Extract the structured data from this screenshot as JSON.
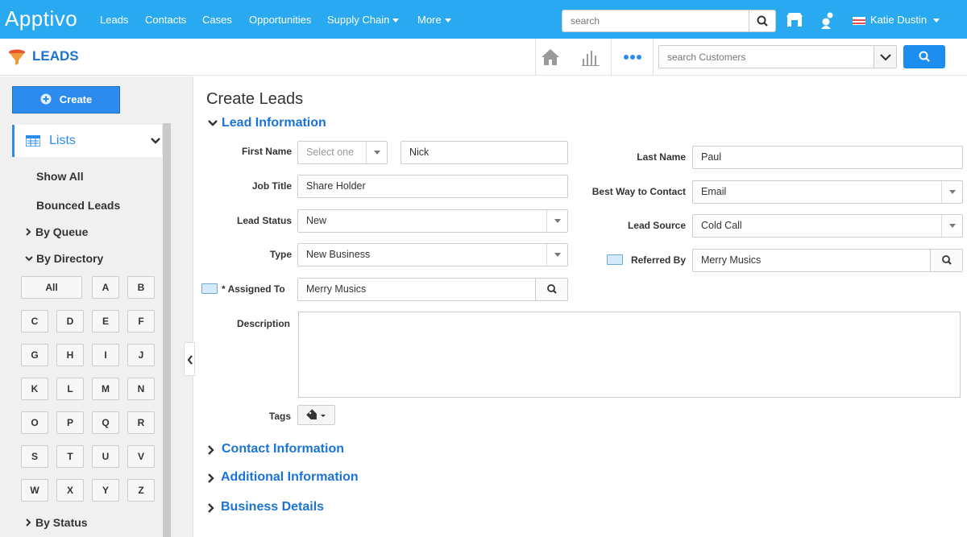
{
  "top": {
    "logo": "Apptivo",
    "nav": [
      "Leads",
      "Contacts",
      "Cases",
      "Opportunities",
      "Supply Chain",
      "More"
    ],
    "search_placeholder": "search",
    "user_name": "Katie Dustin"
  },
  "subheader": {
    "app_title": "LEADS",
    "customer_search_placeholder": "search Customers"
  },
  "sidebar": {
    "create_label": "Create",
    "lists_label": "Lists",
    "items": [
      "Show All",
      "Bounced Leads",
      "By Queue",
      "By Directory",
      "By Status"
    ],
    "alphabet": [
      "All",
      "A",
      "B",
      "C",
      "D",
      "E",
      "F",
      "G",
      "H",
      "I",
      "J",
      "K",
      "L",
      "M",
      "N",
      "O",
      "P",
      "Q",
      "R",
      "S",
      "T",
      "U",
      "V",
      "W",
      "X",
      "Y",
      "Z"
    ]
  },
  "main": {
    "title": "Create Leads",
    "sections": [
      "Lead Information",
      "Contact Information",
      "Additional Information",
      "Business Details"
    ],
    "labels": {
      "first_name": "First Name",
      "last_name": "Last Name",
      "job_title": "Job Title",
      "best_way": "Best Way to Contact",
      "lead_status": "Lead Status",
      "lead_source": "Lead Source",
      "type": "Type",
      "referred_by": "Referred By",
      "assigned_to": "Assigned To",
      "required_mark": "*",
      "description": "Description",
      "tags": "Tags"
    },
    "values": {
      "salutation_placeholder": "Select one",
      "first_name": "Nick",
      "last_name": "Paul",
      "job_title": "Share Holder",
      "best_way": "Email",
      "lead_status": "New",
      "lead_source": "Cold Call",
      "type": "New Business",
      "referred_by": "Merry Musics",
      "assigned_to": "Merry Musics",
      "description": ""
    }
  },
  "colors": {
    "topbar": "#29aaf0",
    "accent": "#1b73d4",
    "button": "#2d8bf0"
  }
}
